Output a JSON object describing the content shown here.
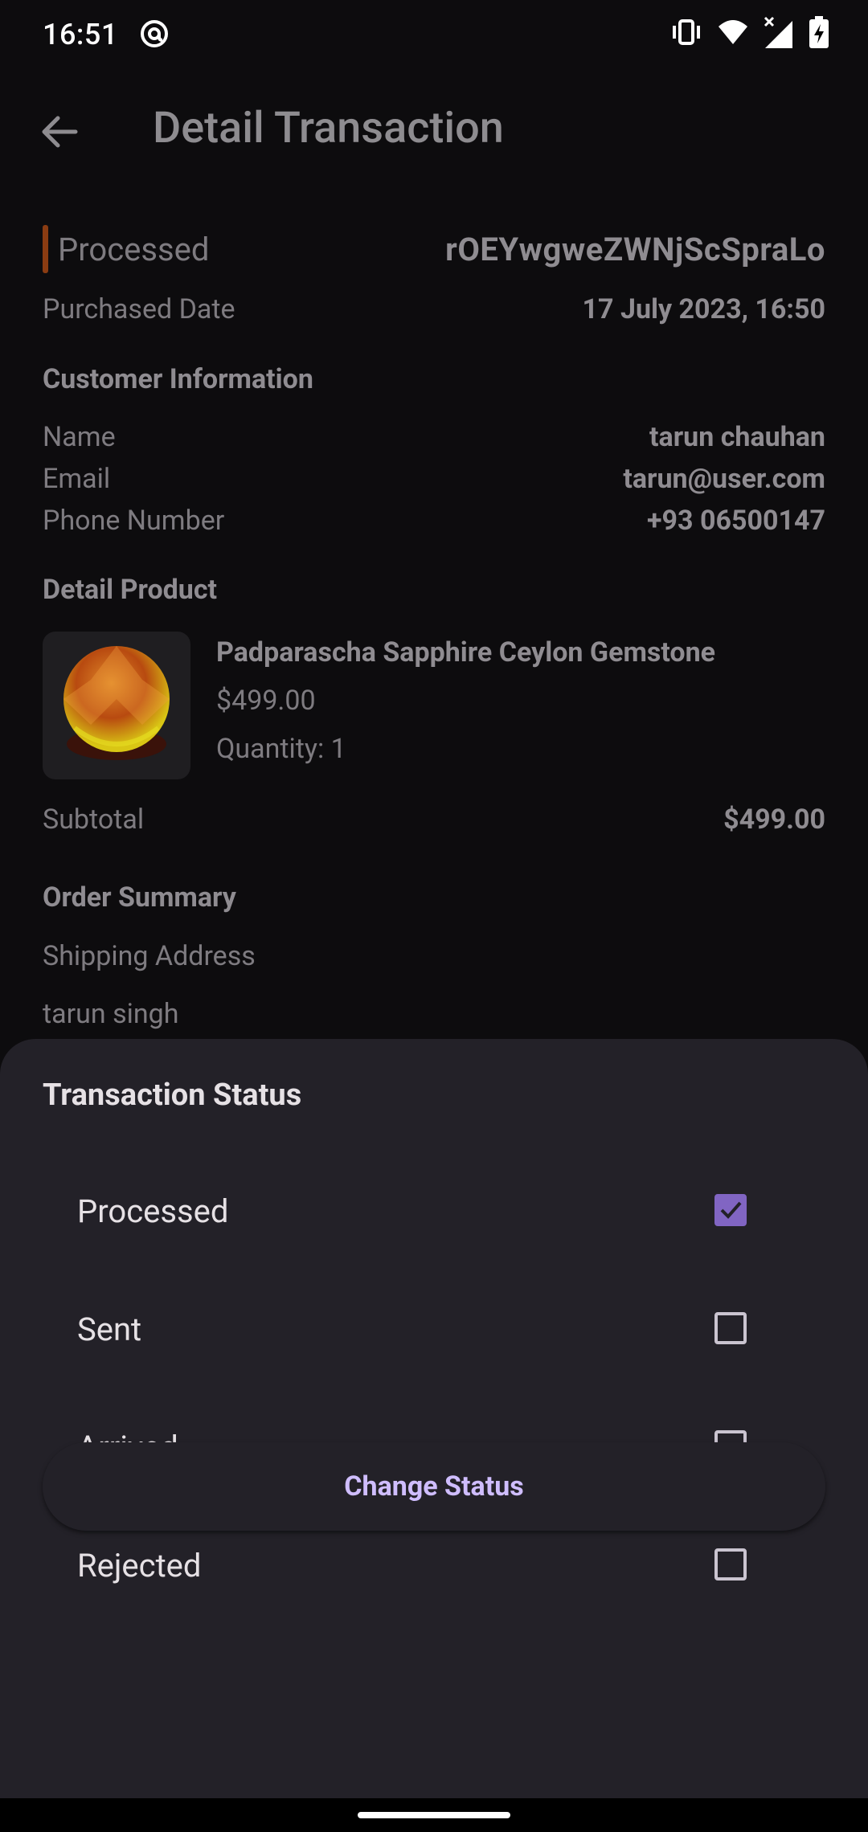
{
  "status_bar": {
    "time": "16:51"
  },
  "appbar": {
    "title": "Detail Transaction"
  },
  "transaction": {
    "status": "Processed",
    "order_id": "rOEYwgweZWNjScSpraLo",
    "purchased_label": "Purchased Date",
    "purchased_value": "17 July 2023, 16:50"
  },
  "customer": {
    "section_title": "Customer Information",
    "name_label": "Name",
    "name_value": "tarun chauhan",
    "email_label": "Email",
    "email_value": "tarun@user.com",
    "phone_label": "Phone Number",
    "phone_value": "+93 06500147"
  },
  "product": {
    "section_title": "Detail Product",
    "name": "Padparascha Sapphire Ceylon Gemstone",
    "price": "$499.00",
    "quantity": "Quantity: 1"
  },
  "subtotal": {
    "label": "Subtotal",
    "value": "$499.00"
  },
  "summary": {
    "section_title": "Order Summary",
    "shipping_label": "Shipping Address",
    "shipping_name": "tarun singh"
  },
  "sheet": {
    "title": "Transaction Status",
    "options": [
      {
        "label": "Processed",
        "checked": true
      },
      {
        "label": "Sent",
        "checked": false
      },
      {
        "label": "Arrived",
        "checked": false
      },
      {
        "label": "Rejected",
        "checked": false
      }
    ],
    "button_label": "Change Status"
  },
  "colors": {
    "accent": "#8165c3",
    "button_text": "#cfbdfe",
    "sheet_bg": "#232128"
  }
}
